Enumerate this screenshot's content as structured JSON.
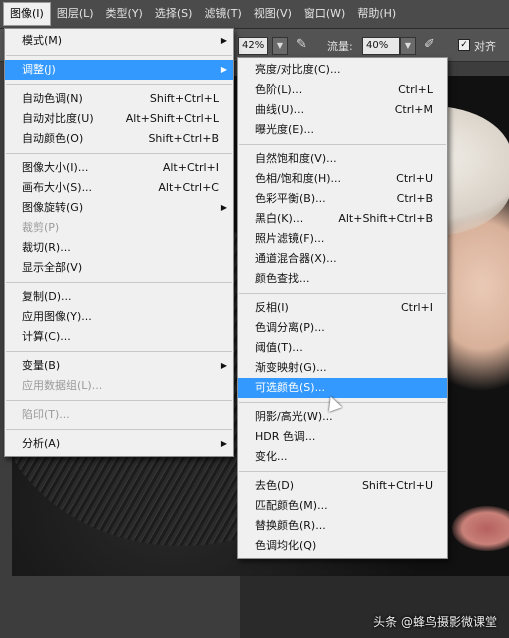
{
  "menubar": {
    "items": [
      "图像(I)",
      "图层(L)",
      "类型(Y)",
      "选择(S)",
      "滤镜(T)",
      "视图(V)",
      "窗口(W)",
      "帮助(H)"
    ]
  },
  "options_bar": {
    "opacity_partial": "42%",
    "flow_label": "流量:",
    "flow_value": "40%",
    "align_label": "对齐"
  },
  "image_menu": {
    "items": [
      {
        "label": "模式(M)",
        "shortcut": "",
        "submenu": true
      },
      {
        "sep": true
      },
      {
        "label": "调整(J)",
        "shortcut": "",
        "submenu": true,
        "highlighted": true
      },
      {
        "sep": true
      },
      {
        "label": "自动色调(N)",
        "shortcut": "Shift+Ctrl+L"
      },
      {
        "label": "自动对比度(U)",
        "shortcut": "Alt+Shift+Ctrl+L"
      },
      {
        "label": "自动颜色(O)",
        "shortcut": "Shift+Ctrl+B"
      },
      {
        "sep": true
      },
      {
        "label": "图像大小(I)...",
        "shortcut": "Alt+Ctrl+I"
      },
      {
        "label": "画布大小(S)...",
        "shortcut": "Alt+Ctrl+C"
      },
      {
        "label": "图像旋转(G)",
        "shortcut": "",
        "submenu": true
      },
      {
        "label": "裁剪(P)",
        "shortcut": "",
        "disabled": true
      },
      {
        "label": "裁切(R)...",
        "shortcut": ""
      },
      {
        "label": "显示全部(V)",
        "shortcut": ""
      },
      {
        "sep": true
      },
      {
        "label": "复制(D)...",
        "shortcut": ""
      },
      {
        "label": "应用图像(Y)...",
        "shortcut": ""
      },
      {
        "label": "计算(C)...",
        "shortcut": ""
      },
      {
        "sep": true
      },
      {
        "label": "变量(B)",
        "shortcut": "",
        "submenu": true
      },
      {
        "label": "应用数据组(L)...",
        "shortcut": "",
        "disabled": true
      },
      {
        "sep": true
      },
      {
        "label": "陷印(T)...",
        "shortcut": "",
        "disabled": true
      },
      {
        "sep": true
      },
      {
        "label": "分析(A)",
        "shortcut": "",
        "submenu": true
      }
    ]
  },
  "adjust_menu": {
    "items": [
      {
        "label": "亮度/对比度(C)...",
        "shortcut": ""
      },
      {
        "label": "色阶(L)...",
        "shortcut": "Ctrl+L"
      },
      {
        "label": "曲线(U)...",
        "shortcut": "Ctrl+M"
      },
      {
        "label": "曝光度(E)...",
        "shortcut": ""
      },
      {
        "sep": true
      },
      {
        "label": "自然饱和度(V)...",
        "shortcut": ""
      },
      {
        "label": "色相/饱和度(H)...",
        "shortcut": "Ctrl+U"
      },
      {
        "label": "色彩平衡(B)...",
        "shortcut": "Ctrl+B"
      },
      {
        "label": "黑白(K)...",
        "shortcut": "Alt+Shift+Ctrl+B"
      },
      {
        "label": "照片滤镜(F)...",
        "shortcut": ""
      },
      {
        "label": "通道混合器(X)...",
        "shortcut": ""
      },
      {
        "label": "颜色查找...",
        "shortcut": ""
      },
      {
        "sep": true
      },
      {
        "label": "反相(I)",
        "shortcut": "Ctrl+I"
      },
      {
        "label": "色调分离(P)...",
        "shortcut": ""
      },
      {
        "label": "阈值(T)...",
        "shortcut": ""
      },
      {
        "label": "渐变映射(G)...",
        "shortcut": ""
      },
      {
        "label": "可选颜色(S)...",
        "shortcut": "",
        "highlighted": true
      },
      {
        "sep": true
      },
      {
        "label": "阴影/高光(W)...",
        "shortcut": ""
      },
      {
        "label": "HDR 色调...",
        "shortcut": ""
      },
      {
        "label": "变化...",
        "shortcut": ""
      },
      {
        "sep": true
      },
      {
        "label": "去色(D)",
        "shortcut": "Shift+Ctrl+U"
      },
      {
        "label": "匹配颜色(M)...",
        "shortcut": ""
      },
      {
        "label": "替换颜色(R)...",
        "shortcut": ""
      },
      {
        "label": "色调均化(Q)",
        "shortcut": ""
      }
    ]
  },
  "watermark": "头条 @蜂鸟摄影微课堂",
  "colors": {
    "highlight": "#3399ff",
    "menu_bg": "#f0f0f0",
    "menubar_bg": "#4b4b4b"
  }
}
